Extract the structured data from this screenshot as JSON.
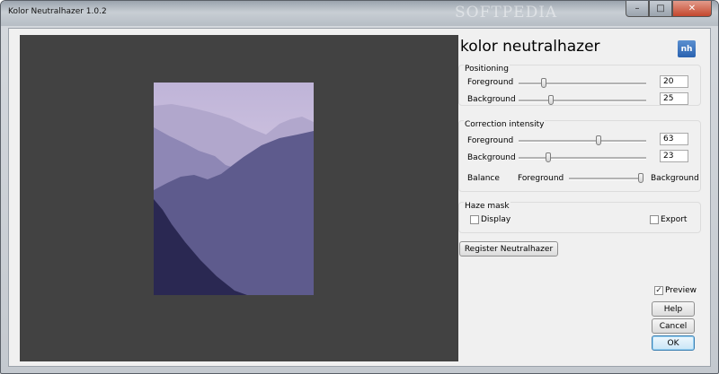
{
  "window": {
    "title": "Kolor Neutralhazer 1.0.2",
    "watermark": "SOFTPEDIA",
    "minimize_glyph": "–",
    "maximize_glyph": "□",
    "close_glyph": "✕"
  },
  "app": {
    "title": "kolor neutralhazer",
    "logo_text": "nh"
  },
  "positioning": {
    "title": "Positioning",
    "foreground": {
      "label": "Foreground",
      "value": "20",
      "level_percent": 20
    },
    "background": {
      "label": "Background",
      "value": "25",
      "level_percent": 25
    }
  },
  "correction": {
    "title": "Correction intensity",
    "foreground": {
      "label": "Foreground",
      "value": "63",
      "level_percent": 63
    },
    "background": {
      "label": "Background",
      "value": "23",
      "level_percent": 23
    },
    "balance": {
      "label": "Balance",
      "left": "Foreground",
      "right": "Background",
      "level_percent": 100
    }
  },
  "haze_mask": {
    "title": "Haze mask",
    "display": {
      "label": "Display",
      "checked": false
    },
    "export": {
      "label": "Export",
      "checked": false
    }
  },
  "buttons": {
    "register": "Register Neutralhazer",
    "preview": {
      "label": "Preview",
      "checked": true
    },
    "help": "Help",
    "cancel": "Cancel",
    "ok": "OK"
  },
  "colors": {
    "preview_background": "#424242",
    "sky_top": "#bfb4d8",
    "sky_glow": "#e8dcec",
    "mountain_far": "#b1a7cc",
    "mountain_mid": "#8e87b5",
    "mountain_near": "#5e5b8d",
    "foreground_slope": "#2a2852"
  }
}
